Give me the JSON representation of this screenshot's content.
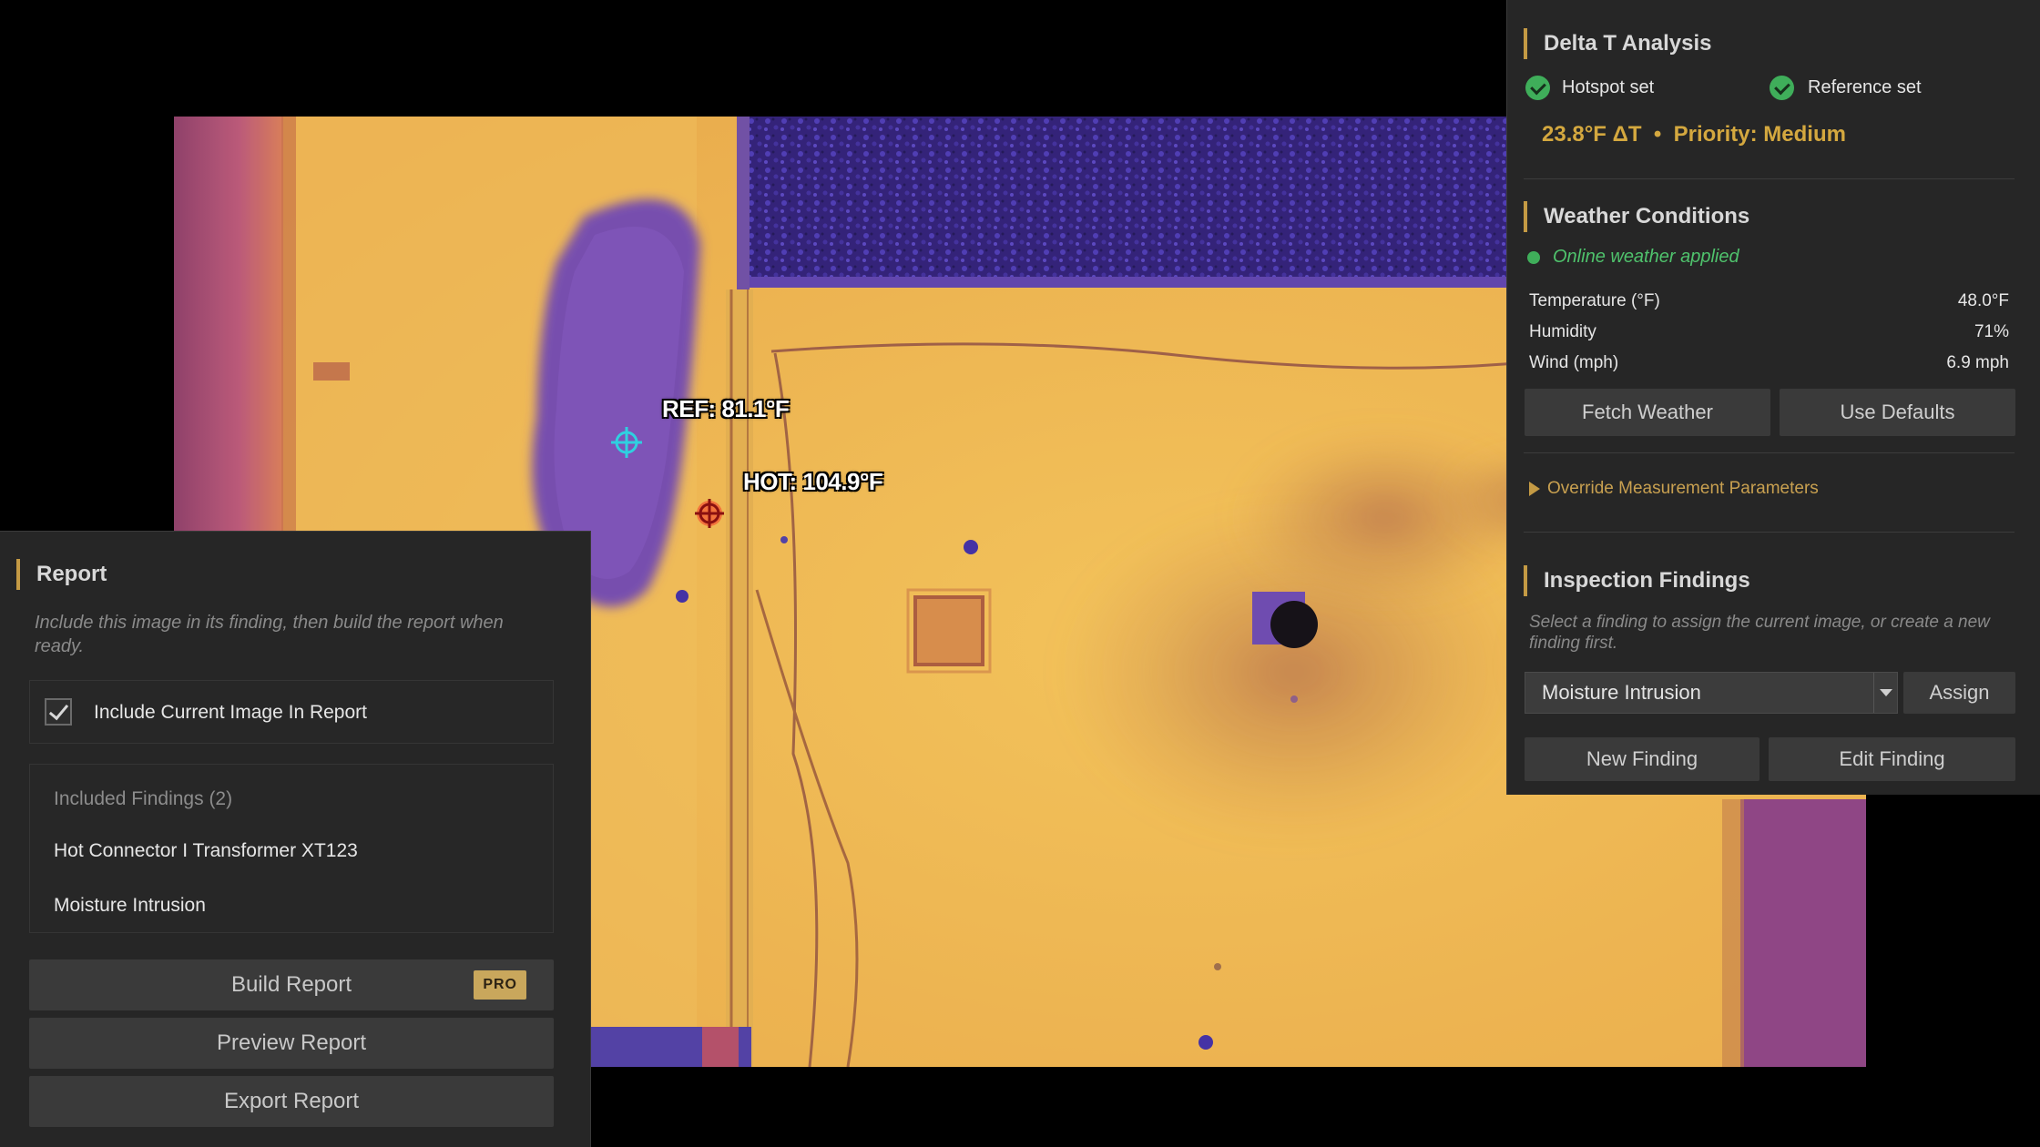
{
  "image": {
    "ref_label": "REF: 81.1°F",
    "hot_label": "HOT: 104.9°F"
  },
  "delta_t": {
    "title": "Delta T Analysis",
    "hotspot_status": "Hotspot set",
    "reference_status": "Reference set",
    "summary": "23.8°F ΔT  •  Priority: Medium",
    "accent_color": "#d4a83f"
  },
  "weather": {
    "title": "Weather Conditions",
    "status": "Online weather applied",
    "status_color": "#3fae5a",
    "rows": [
      {
        "label": "Temperature (°F)",
        "value": "48.0°F"
      },
      {
        "label": "Humidity",
        "value": "71%"
      },
      {
        "label": "Wind (mph)",
        "value": "6.9 mph"
      }
    ],
    "fetch_label": "Fetch Weather",
    "defaults_label": "Use Defaults",
    "override_label": "Override Measurement Parameters"
  },
  "findings": {
    "title": "Inspection Findings",
    "hint": "Select a finding to assign the current image, or create a new finding first.",
    "selected": "Moisture Intrusion",
    "assign_label": "Assign",
    "new_label": "New Finding",
    "edit_label": "Edit Finding"
  },
  "report": {
    "title": "Report",
    "hint": "Include this image in its finding, then build the report when ready.",
    "include_label": "Include Current Image In Report",
    "include_checked": true,
    "included_header": "Included Findings (2)",
    "included_items": [
      "Hot Connector I Transformer XT123",
      "Moisture Intrusion"
    ],
    "build_label": "Build Report",
    "pro_badge": "PRO",
    "preview_label": "Preview Report",
    "export_label": "Export Report"
  }
}
